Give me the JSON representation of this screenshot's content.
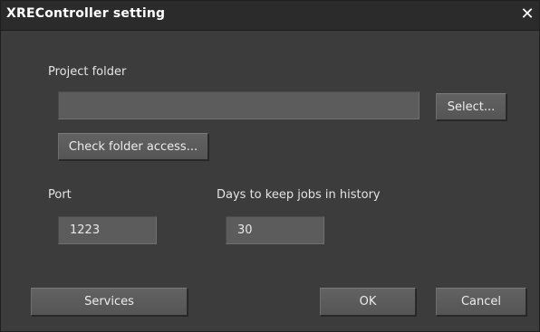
{
  "window": {
    "title": "XREController setting",
    "close_glyph": "✕"
  },
  "project_folder": {
    "label": "Project folder",
    "value": "",
    "select_button": "Select...",
    "check_button": "Check folder access..."
  },
  "port": {
    "label": "Port",
    "value": "1223"
  },
  "history": {
    "label": "Days to keep jobs in history",
    "value": "30"
  },
  "footer": {
    "services_button": "Services",
    "ok_button": "OK",
    "cancel_button": "Cancel"
  }
}
